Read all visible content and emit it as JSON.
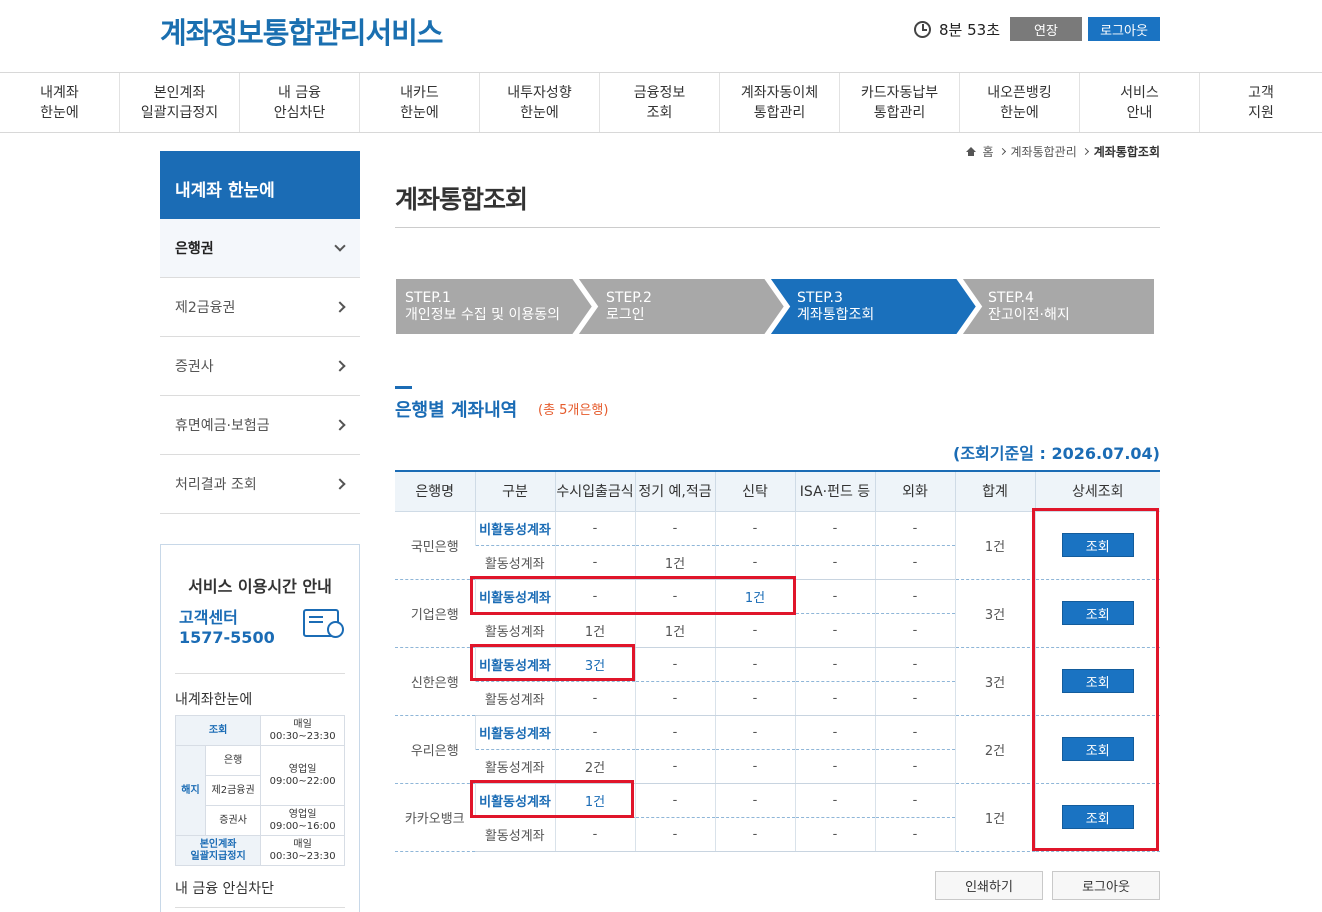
{
  "header": {
    "logo": "계좌정보통합관리서비스",
    "timer": "8분 53초",
    "extend_label": "연장",
    "logout_label": "로그아웃"
  },
  "gnb": [
    "내계좌\n한눈에",
    "본인계좌\n일괄지급정지",
    "내 금융\n안심차단",
    "내카드\n한눈에",
    "내투자성향\n한눈에",
    "금융정보\n조회",
    "계좌자동이체\n통합관리",
    "카드자동납부\n통합관리",
    "내오픈뱅킹\n한눈에",
    "서비스\n안내",
    "고객\n지원"
  ],
  "sidebar": {
    "title": "내계좌 한눈에",
    "items": [
      "은행권",
      "제2금융권",
      "증권사",
      "휴면예금·보험금",
      "처리결과 조회"
    ],
    "service": {
      "title": "서비스 이용시간 안내",
      "cs_label": "고객센터",
      "cs_phone": "1577-5500",
      "sub1": "내계좌한눈에",
      "t_inquiry": "조회",
      "t_daily": "매일",
      "t_time1": "00:30~23:30",
      "t_cancel": "해지",
      "t_bank": "은행",
      "t_bizday": "영업일",
      "t_time2": "09:00~22:00",
      "t_second": "제2금융권",
      "t_securities": "증권사",
      "t_bizday2": "영업일",
      "t_time3": "09:00~16:00",
      "t_stop": "본인계좌\n일괄지급정지",
      "t_daily2": "매일",
      "t_time4": "00:30~23:30",
      "sub2": "내 금융 안심차단"
    }
  },
  "breadcrumb": {
    "home": "홈",
    "level1": "계좌통합관리",
    "current": "계좌통합조회"
  },
  "page_title": "계좌통합조회",
  "steps": [
    {
      "no": "STEP.1",
      "label": "개인정보 수집 및 이용동의"
    },
    {
      "no": "STEP.2",
      "label": "로그인"
    },
    {
      "no": "STEP.3",
      "label": "계좌통합조회"
    },
    {
      "no": "STEP.4",
      "label": "잔고이전·해지"
    }
  ],
  "section": {
    "title": "은행별 계좌내역",
    "count": "(총 5개은행)",
    "ref_date": "(조회기준일 : 2026.07.04)"
  },
  "table": {
    "headers": [
      "은행명",
      "구분",
      "수시입출금식",
      "정기 예,적금",
      "신탁",
      "ISA·펀드 등",
      "외화",
      "합계",
      "상세조회"
    ],
    "inactive_label": "비활동성계좌",
    "active_label": "활동성계좌",
    "detail_label": "조회",
    "rows": [
      {
        "bank": "국민은행",
        "total": "1건",
        "inactive": [
          "-",
          "-",
          "-",
          "-",
          "-"
        ],
        "active": [
          "-",
          "1건",
          "-",
          "-",
          "-"
        ]
      },
      {
        "bank": "기업은행",
        "total": "3건",
        "inactive": [
          "-",
          "-",
          "1건",
          "-",
          "-"
        ],
        "active": [
          "1건",
          "1건",
          "-",
          "-",
          "-"
        ]
      },
      {
        "bank": "신한은행",
        "total": "3건",
        "inactive": [
          "3건",
          "-",
          "-",
          "-",
          "-"
        ],
        "active": [
          "-",
          "-",
          "-",
          "-",
          "-"
        ]
      },
      {
        "bank": "우리은행",
        "total": "2건",
        "inactive": [
          "-",
          "-",
          "-",
          "-",
          "-"
        ],
        "active": [
          "2건",
          "-",
          "-",
          "-",
          "-"
        ]
      },
      {
        "bank": "카카오뱅크",
        "total": "1건",
        "inactive": [
          "1건",
          "-",
          "-",
          "-",
          "-"
        ],
        "active": [
          "-",
          "-",
          "-",
          "-",
          "-"
        ]
      }
    ]
  },
  "bottom_buttons": {
    "print": "인쇄하기",
    "logout": "로그아웃"
  }
}
